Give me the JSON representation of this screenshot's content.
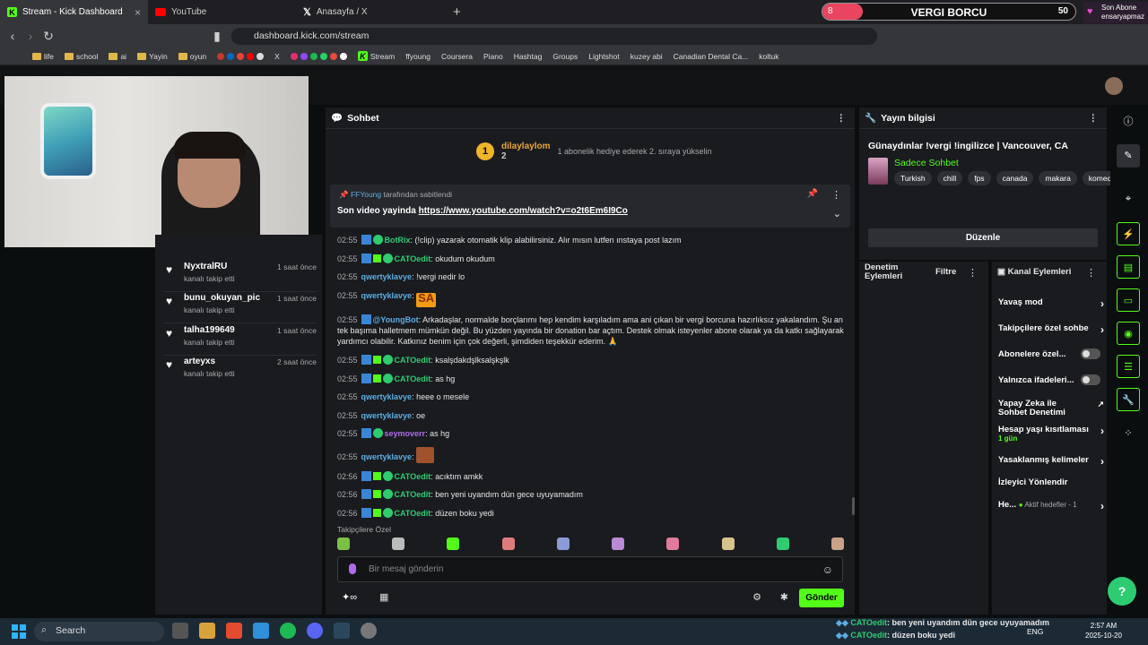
{
  "browser": {
    "tabs": [
      {
        "label": "Stream - Kick Dashboard",
        "active": true
      },
      {
        "label": "YouTube"
      },
      {
        "label": "Anasayfa / X"
      }
    ],
    "url": "dashboard.kick.com/stream",
    "bookmarks": [
      "life",
      "school",
      "ai",
      "Yayin",
      "oyun",
      "X",
      "Stream",
      "ffyoung",
      "Coursera",
      "Piano",
      "Hashtag",
      "Groups",
      "Lightshot",
      "kuzey abi",
      "Canadian Dental Ca...",
      "koltuk"
    ]
  },
  "overlay": {
    "current": "8",
    "title": "VERGI BORCU",
    "goal": "50",
    "fill_fraction": 0.16,
    "sub_label": "Son Abone",
    "sub_name": "ensaryapmaz"
  },
  "followers": [
    {
      "name": "NyxtralRU",
      "time": "1 saat önce",
      "status": "kanalı takip etti"
    },
    {
      "name": "bunu_okuyan_pic",
      "time": "1 saat önce",
      "status": "kanalı takip etti"
    },
    {
      "name": "talha199649",
      "time": "1 saat önce",
      "status": "kanalı takip etti"
    },
    {
      "name": "arteyxs",
      "time": "2 saat önce",
      "status": "kanalı takip etti"
    }
  ],
  "chat": {
    "header": "Sohbet",
    "gift": {
      "rank": "1",
      "name": "dilaylaylom",
      "count": "2",
      "text": "1 abonelik hediye ederek 2. sıraya yükselin"
    },
    "pinned": {
      "by_user": "FFYoung",
      "by_text": "tarafından sabitlendi",
      "text": "Son video yayinda",
      "link": "https://www.youtube.com/watch?v=o2t6Em6I9Co"
    },
    "messages": [
      {
        "ts": "02:55",
        "user": "BotRix",
        "color": "#2ecc71",
        "badges": 2,
        "text": "!clip) yazarak otomatik klip alabilirsiniz. Alır mısın lutfen ınstaya post lazım",
        "prefix": "(",
        "raw": "(!clip) yazarak otomatik klip alabilirsiniz. Alır mısın lutfen ınstaya post lazım"
      },
      {
        "ts": "02:55",
        "user": "CATOedit",
        "color": "#2ecc71",
        "badges": 3,
        "text": "okudum okudum"
      },
      {
        "ts": "02:55",
        "user": "qwertyklavye",
        "color": "#5dade2",
        "badges": 0,
        "text": "!vergi nedir lo"
      },
      {
        "ts": "02:55",
        "user": "qwertyklavye",
        "color": "#5dade2",
        "badges": 0,
        "text": "SA"
      },
      {
        "ts": "02:55",
        "user": "@YoungBot",
        "color": "#5dade2",
        "badges": 1,
        "text": "Arkadaşlar, normalde borçlarımı hep kendim karşıladım ama ani çıkan bir vergi borcuna hazırlıksız yakalandım. Şu an tek başıma halletmem mümkün değil. Bu yüzden yayında bir donation bar açtım. Destek olmak isteyenler abone olarak ya da katkı sağlayarak yardımcı olabilir. Katkınız benim için çok değerli, şimdiden teşekkür ederim. 🙏"
      },
      {
        "ts": "02:55",
        "user": "CATOedit",
        "color": "#2ecc71",
        "badges": 3,
        "text": "ksalşdakdşlksalşkşlk"
      },
      {
        "ts": "02:55",
        "user": "CATOedit",
        "color": "#2ecc71",
        "badges": 3,
        "text": "as hg"
      },
      {
        "ts": "02:55",
        "user": "qwertyklavye",
        "color": "#5dade2",
        "badges": 0,
        "text": "heee o mesele"
      },
      {
        "ts": "02:55",
        "user": "qwertyklavye",
        "color": "#5dade2",
        "badges": 0,
        "text": "oe"
      },
      {
        "ts": "02:55",
        "user": "seymoverr",
        "color": "#b06ae8",
        "badges": 2,
        "text": "as hg"
      },
      {
        "ts": "02:55",
        "user": "qwertyklavye",
        "color": "#5dade2",
        "badges": 0,
        "text": ""
      },
      {
        "ts": "02:56",
        "user": "CATOedit",
        "color": "#2ecc71",
        "badges": 3,
        "text": "acıktım amkk"
      },
      {
        "ts": "02:56",
        "user": "CATOedit",
        "color": "#2ecc71",
        "badges": 3,
        "text": "ben yeni uyandım dün gece uyuyamadım"
      },
      {
        "ts": "02:56",
        "user": "CATOedit",
        "color": "#2ecc71",
        "badges": 3,
        "text": "düzen boku yedi"
      }
    ],
    "emotes_label": "Takipçilere Özel",
    "input_placeholder": "Bir mesaj gönderin",
    "send_label": "Gönder"
  },
  "stream_info": {
    "header": "Yayın bilgisi",
    "title": "Günaydınlar !vergi !ingilizce | Vancouver, CA",
    "category": "Sadece Sohbet",
    "tags": [
      "Turkish",
      "chill",
      "fps",
      "canada",
      "makara",
      "komedi"
    ],
    "edit_label": "Düzenle"
  },
  "mod": {
    "header": "Denetim Eylemleri",
    "filter": "Filtre"
  },
  "channel_actions": {
    "header": "Kanal Eylemleri",
    "items": [
      {
        "label": "Yavaş mod",
        "kind": "arrow"
      },
      {
        "label": "Takipçilere özel sohbe",
        "kind": "arrow"
      },
      {
        "label": "Abonelere özel...",
        "kind": "toggle"
      },
      {
        "label": "Yalnızca ifadeleri...",
        "kind": "toggle"
      },
      {
        "label": "Yapay Zeka ile Sohbet Denetimi",
        "kind": "ext"
      },
      {
        "label": "Hesap yaşı kısıtlaması",
        "sub": "1 gün",
        "kind": "arrow"
      },
      {
        "label": "Yasaklanmış kelimeler",
        "kind": "arrow"
      },
      {
        "label": "İzleyici Yönlendir",
        "kind": "none"
      },
      {
        "label": "He...",
        "sub": "Aktif hedefler - 1",
        "kind": "arrow"
      }
    ]
  },
  "taskbar": {
    "search": "Search",
    "lang": "ENG",
    "time": "2:57 AM",
    "date": "2025-10-20"
  },
  "notifications": [
    {
      "user": "CATOedit",
      "text": ": ben yeni uyandım dün gece uyuyamadım"
    },
    {
      "user": "CATOedit",
      "text": ": düzen boku yedi"
    }
  ]
}
